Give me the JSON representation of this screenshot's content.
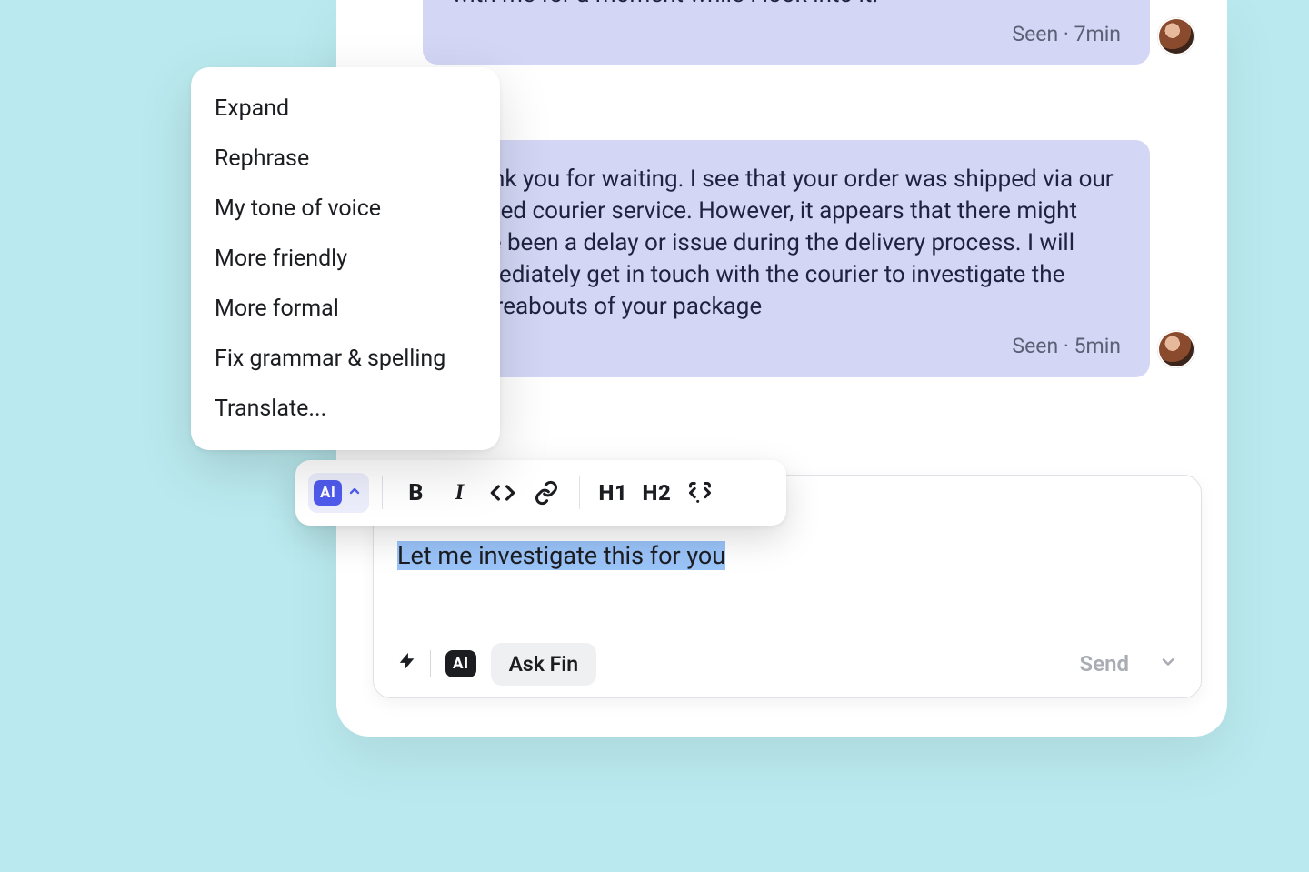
{
  "messages": [
    {
      "body": "delivered yet. I'll do my best to resolve this for you. Please bear with me for a moment while I look into it.",
      "status": "Seen",
      "time": "7min"
    },
    {
      "body": "Thank you for waiting. I see that your order was shipped via our trusted courier service. However, it appears that there might have been a delay or issue during the delivery process. I will immediately get in touch with the courier to investigate the whereabouts of your package",
      "status": "Seen",
      "time": "5min"
    }
  ],
  "ai_menu": {
    "items": [
      "Expand",
      "Rephrase",
      "My tone of voice",
      "More friendly",
      "More formal",
      "Fix grammar & spelling",
      "Translate..."
    ]
  },
  "toolbar": {
    "ai_label": "AI",
    "bold": "B",
    "italic": "I",
    "h1": "H1",
    "h2": "H2"
  },
  "composer": {
    "draft": "Let me investigate this for you",
    "ai_label": "AI",
    "ask_fin": "Ask Fin",
    "send": "Send"
  },
  "meta_separator": " · "
}
